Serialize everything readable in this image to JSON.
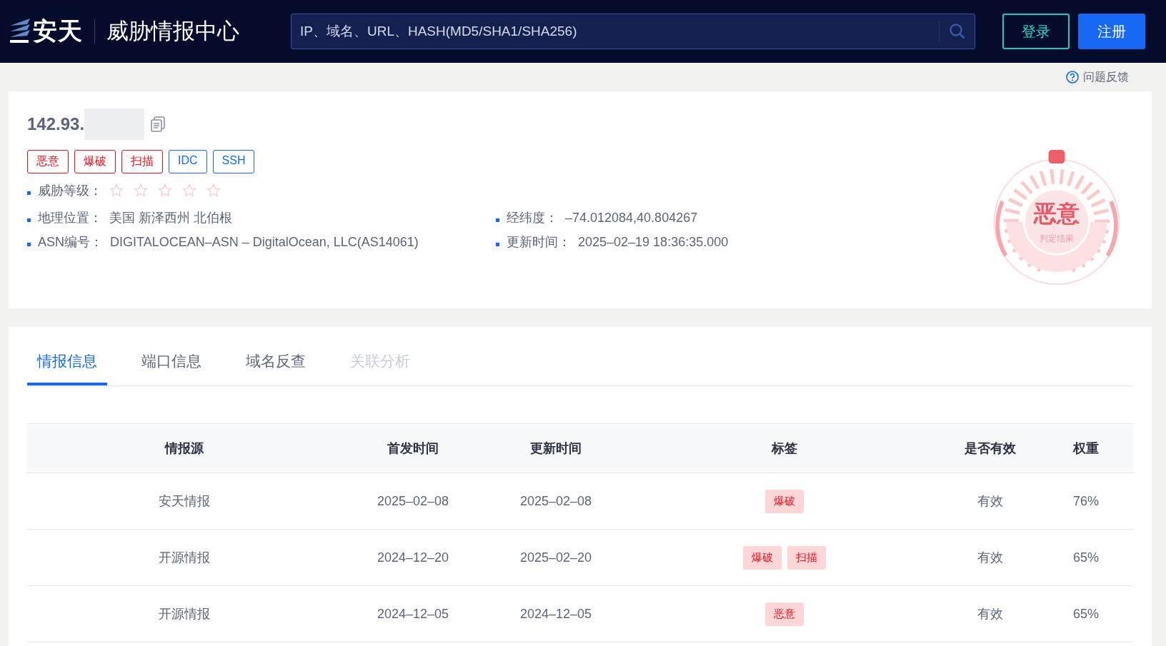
{
  "header": {
    "brand": "安天",
    "title": "威胁情报中心",
    "search": {
      "placeholder": "IP、域名、URL、HASH(MD5/SHA1/SHA256)"
    },
    "login": "登录",
    "register": "注册"
  },
  "feedback": "问题反馈",
  "summary": {
    "ip": "142.93.",
    "tags": [
      {
        "label": "恶意",
        "kind": "danger"
      },
      {
        "label": "爆破",
        "kind": "danger"
      },
      {
        "label": "扫描",
        "kind": "danger"
      },
      {
        "label": "IDC",
        "kind": "info"
      },
      {
        "label": "SSH",
        "kind": "info"
      }
    ],
    "threat_level": {
      "label": "威胁等级：",
      "stars": 0
    },
    "fields": [
      {
        "label": "地理位置：",
        "value": "美国 新泽西州 北伯根"
      },
      {
        "label": "经纬度：",
        "value": "–74.012084,40.804267"
      },
      {
        "label": "ASN编号：",
        "value": "DIGITALOCEAN–ASN – DigitalOcean, LLC(AS14061)"
      },
      {
        "label": "更新时间：",
        "value": "2025–02–19 18:36:35.000"
      }
    ],
    "verdict": {
      "label": "恶意",
      "caption": "判定结果"
    }
  },
  "tabs": [
    {
      "label": "情报信息",
      "selected": true,
      "disabled": false
    },
    {
      "label": "端口信息",
      "selected": false,
      "disabled": false
    },
    {
      "label": "域名反查",
      "selected": false,
      "disabled": false
    },
    {
      "label": "关联分析",
      "selected": false,
      "disabled": true
    }
  ],
  "table": {
    "columns": [
      "情报源",
      "首发时间",
      "更新时间",
      "标签",
      "是否有效",
      "权重"
    ],
    "rows": [
      {
        "source": "安天情报",
        "first": "2025–02–08",
        "updated": "2025–02–08",
        "tags": [
          "爆破"
        ],
        "valid": "有效",
        "weight": "76%"
      },
      {
        "source": "开源情报",
        "first": "2024–12–20",
        "updated": "2025–02–20",
        "tags": [
          "爆破",
          "扫描"
        ],
        "valid": "有效",
        "weight": "65%"
      },
      {
        "source": "开源情报",
        "first": "2024–12–05",
        "updated": "2024–12–05",
        "tags": [
          "恶意"
        ],
        "valid": "有效",
        "weight": "65%"
      }
    ]
  }
}
